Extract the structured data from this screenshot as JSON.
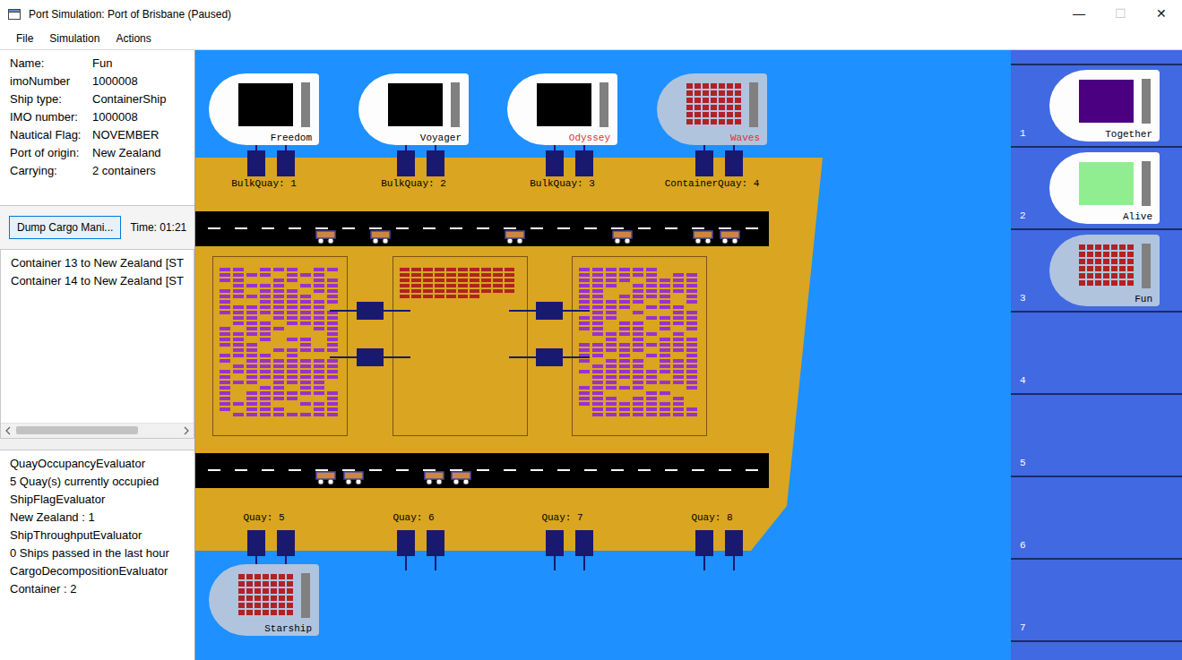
{
  "window": {
    "title": "Port Simulation: Port of Brisbane (Paused)",
    "controls": [
      {
        "glyph": "—",
        "disabled": false
      },
      {
        "glyph": "☐",
        "disabled": true
      },
      {
        "glyph": "✕",
        "disabled": false
      }
    ]
  },
  "menu": [
    "File",
    "Simulation",
    "Actions"
  ],
  "ship_info": [
    {
      "label": "Name:",
      "value": "Fun"
    },
    {
      "label": "imoNumber",
      "value": "1000008"
    },
    {
      "label": "Ship type:",
      "value": "ContainerShip"
    },
    {
      "label": "IMO number:",
      "value": "1000008"
    },
    {
      "label": "Nautical Flag:",
      "value": "NOVEMBER"
    },
    {
      "label": "Port of origin:",
      "value": "New Zealand"
    },
    {
      "label": "Carrying:",
      "value": "2 containers"
    }
  ],
  "dump_button": "Dump Cargo Mani...",
  "time": "Time: 01:21",
  "manifest": [
    "Container 13 to New Zealand [ST",
    "Container 14 to New Zealand [ST"
  ],
  "evaluators": [
    "QuayOccupancyEvaluator",
    "5 Quay(s) currently occupied",
    "ShipFlagEvaluator",
    "New Zealand : 1",
    "ShipThroughputEvaluator",
    "0 Ships passed in the last hour",
    "CargoDecompositionEvaluator",
    "Container : 2"
  ],
  "quays": [
    {
      "label": "BulkQuay: 1",
      "ship": {
        "name": "Freedom",
        "kind": "bulk",
        "cargo_color": "#000000",
        "name_color": "#000000"
      }
    },
    {
      "label": "BulkQuay: 2",
      "ship": {
        "name": "Voyager",
        "kind": "bulk",
        "cargo_color": "#000000",
        "name_color": "#000000"
      }
    },
    {
      "label": "BulkQuay: 3",
      "ship": {
        "name": "Odyssey",
        "kind": "bulk",
        "cargo_color": "#000000",
        "name_color": "#e03030"
      }
    },
    {
      "label": "ContainerQuay: 4",
      "ship": {
        "name": "Waves",
        "kind": "container",
        "name_color": "#e03030"
      }
    },
    {
      "label": "Quay: 5",
      "ship": {
        "name": "Starship",
        "kind": "container",
        "name_color": "#000000"
      }
    },
    {
      "label": "Quay: 6",
      "ship": null
    },
    {
      "label": "Quay: 7",
      "ship": null
    },
    {
      "label": "Quay: 8",
      "ship": null
    }
  ],
  "queue": [
    {
      "slot": "1",
      "ship": {
        "name": "Together",
        "kind": "bulk",
        "cargo_color": "#4b0082",
        "name_color": "#000000"
      }
    },
    {
      "slot": "2",
      "ship": {
        "name": "Alive",
        "kind": "bulk",
        "cargo_color": "#90ee90",
        "name_color": "#000000"
      }
    },
    {
      "slot": "3",
      "ship": {
        "name": "Fun",
        "kind": "container",
        "name_color": "#000000"
      }
    },
    {
      "slot": "4",
      "ship": null
    },
    {
      "slot": "5",
      "ship": null
    },
    {
      "slot": "6",
      "ship": null
    },
    {
      "slot": "7",
      "ship": null
    }
  ]
}
